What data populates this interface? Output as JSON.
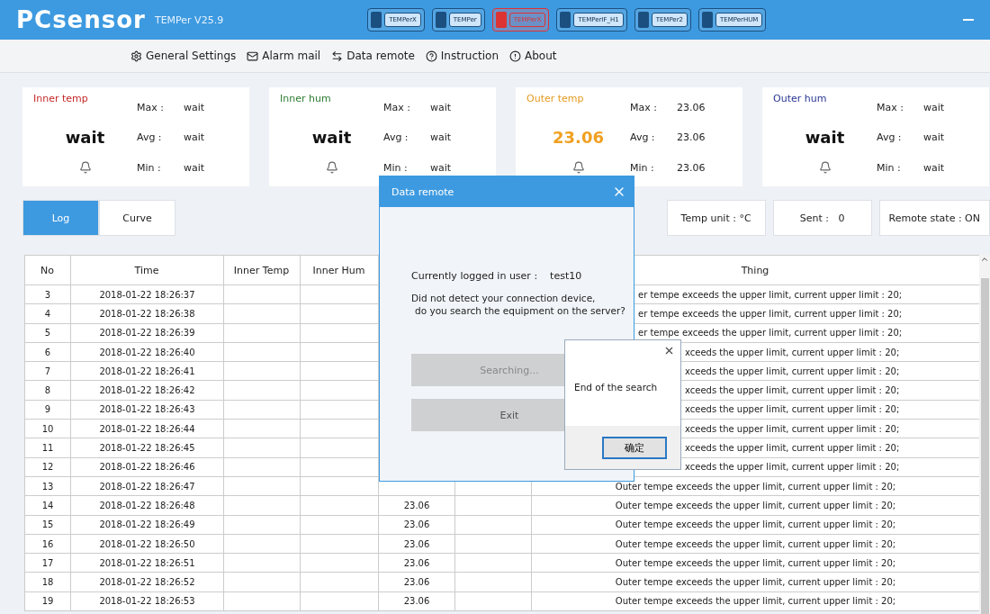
{
  "app": {
    "logo": "PCsensor",
    "version": "TEMPer V25.9"
  },
  "devices": [
    {
      "label": "TEMPerX",
      "alert": false
    },
    {
      "label": "TEMPer",
      "alert": false
    },
    {
      "label": "TEMPerX",
      "alert": true
    },
    {
      "label": "TEMPerIF_H1",
      "alert": false
    },
    {
      "label": "TEMPer2",
      "alert": false
    },
    {
      "label": "TEMPerHUM",
      "alert": false
    }
  ],
  "menu": [
    {
      "label": "General Settings",
      "kind": "settings"
    },
    {
      "label": "Alarm mail",
      "kind": "mail"
    },
    {
      "label": "Data remote",
      "kind": "remote"
    },
    {
      "label": "Instruction",
      "kind": "help"
    },
    {
      "label": "About",
      "kind": "about"
    }
  ],
  "cards": [
    {
      "title": "Inner temp",
      "color": "#c62828",
      "value": "wait",
      "alarm": false,
      "stats": [
        {
          "label": "Max :",
          "value": "wait"
        },
        {
          "label": "Avg :",
          "value": "wait"
        },
        {
          "label": "Min :",
          "value": "wait"
        }
      ]
    },
    {
      "title": "Inner hum",
      "color": "#2e7d32",
      "value": "wait",
      "alarm": false,
      "stats": [
        {
          "label": "Max :",
          "value": "wait"
        },
        {
          "label": "Avg :",
          "value": "wait"
        },
        {
          "label": "Min :",
          "value": "wait"
        }
      ]
    },
    {
      "title": "Outer temp",
      "color": "#e69a1f",
      "value": "23.06",
      "alarm": true,
      "stats": [
        {
          "label": "Max :",
          "value": "23.06"
        },
        {
          "label": "Avg :",
          "value": "23.06"
        },
        {
          "label": "Min :",
          "value": "23.06"
        }
      ]
    },
    {
      "title": "Outer hum",
      "color": "#283593",
      "value": "wait",
      "alarm": false,
      "stats": [
        {
          "label": "Max :",
          "value": "wait"
        },
        {
          "label": "Avg :",
          "value": "wait"
        },
        {
          "label": "Min :",
          "value": "wait"
        }
      ]
    }
  ],
  "tabs": [
    {
      "label": "Log",
      "selected": true
    },
    {
      "label": "Curve",
      "selected": false
    }
  ],
  "status": [
    "Temp unit : °C",
    "Sent :   0",
    "Remote state : ON"
  ],
  "table": {
    "columns": [
      "No",
      "Time",
      "Inner Temp",
      "Inner Hum",
      "Thing"
    ],
    "rows": [
      {
        "no": "3",
        "time": "2018-01-22 18:26:37",
        "kind": "dialog",
        "thing": "er tempe exceeds the upper limit, current upper limit : 20;"
      },
      {
        "no": "4",
        "time": "2018-01-22 18:26:38",
        "kind": "dialog",
        "thing": "er tempe exceeds the upper limit, current upper limit : 20;"
      },
      {
        "no": "5",
        "time": "2018-01-22 18:26:39",
        "kind": "dialog",
        "thing": "er tempe exceeds the upper limit, current upper limit : 20;"
      },
      {
        "no": "6",
        "time": "2018-01-22 18:26:40",
        "kind": "box",
        "thing": "xceeds the upper limit, current upper limit : 20;"
      },
      {
        "no": "7",
        "time": "2018-01-22 18:26:41",
        "kind": "box",
        "thing": "xceeds the upper limit, current upper limit : 20;"
      },
      {
        "no": "8",
        "time": "2018-01-22 18:26:42",
        "kind": "box",
        "thing": "xceeds the upper limit, current upper limit : 20;"
      },
      {
        "no": "9",
        "time": "2018-01-22 18:26:43",
        "kind": "box",
        "thing": "xceeds the upper limit, current upper limit : 20;"
      },
      {
        "no": "10",
        "time": "2018-01-22 18:26:44",
        "kind": "box",
        "thing": "xceeds the upper limit, current upper limit : 20;"
      },
      {
        "no": "11",
        "time": "2018-01-22 18:26:45",
        "kind": "box",
        "thing": "xceeds the upper limit, current upper limit : 20;"
      },
      {
        "no": "12",
        "time": "2018-01-22 18:26:46",
        "kind": "box",
        "thing": "xceeds the upper limit, current upper limit : 20;"
      },
      {
        "no": "13",
        "time": "2018-01-22 18:26:47",
        "thing": "Outer tempe exceeds the upper limit, current upper limit : 20;"
      },
      {
        "no": "14",
        "time": "2018-01-22 18:26:48",
        "column_5": "23.06",
        "thing": "Outer tempe exceeds the upper limit, current upper limit : 20;"
      },
      {
        "no": "15",
        "time": "2018-01-22 18:26:49",
        "column_5": "23.06",
        "thing": "Outer tempe exceeds the upper limit, current upper limit : 20;"
      },
      {
        "no": "16",
        "time": "2018-01-22 18:26:50",
        "column_5": "23.06",
        "thing": "Outer tempe exceeds the upper limit, current upper limit : 20;"
      },
      {
        "no": "17",
        "time": "2018-01-22 18:26:51",
        "column_5": "23.06",
        "thing": "Outer tempe exceeds the upper limit, current upper limit : 20;"
      },
      {
        "no": "18",
        "time": "2018-01-22 18:26:52",
        "column_5": "23.06",
        "thing": "Outer tempe exceeds the upper limit, current upper limit : 20;"
      },
      {
        "no": "19",
        "time": "2018-01-22 18:26:53",
        "column_5": "23.06",
        "thing": "Outer tempe exceeds the upper limit, current upper limit : 20;"
      }
    ]
  },
  "dialog": {
    "title": "Data remote",
    "user_label": "Currently logged in user :",
    "user": "test10",
    "message": [
      "Did not detect your connection device,",
      "do you search the equipment on the server?"
    ],
    "buttons": [
      {
        "label": "Searching...",
        "disabled": true
      },
      {
        "label": "Exit",
        "disabled": false
      }
    ]
  },
  "message_box": {
    "text": "End of the search",
    "button": "确定"
  }
}
